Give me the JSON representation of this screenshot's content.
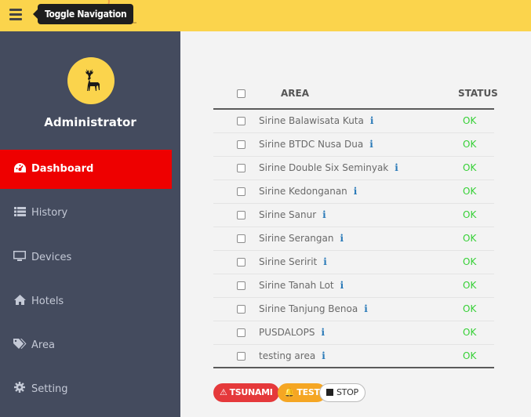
{
  "topbar": {
    "tooltip": "Toggle Navigation"
  },
  "sidebar": {
    "role": "Administrator",
    "items": [
      {
        "label": "Dashboard",
        "icon": "dashboard-icon"
      },
      {
        "label": "History",
        "icon": "list-icon"
      },
      {
        "label": "Devices",
        "icon": "monitor-icon"
      },
      {
        "label": "Hotels",
        "icon": "home-icon"
      },
      {
        "label": "Area",
        "icon": "tag-icon"
      },
      {
        "label": "Setting",
        "icon": "gear-icon"
      }
    ]
  },
  "table": {
    "headers": {
      "area": "AREA",
      "status": "STATUS"
    },
    "info_glyph": "i",
    "rows": [
      {
        "area": "Sirine Balawisata Kuta",
        "status": "OK"
      },
      {
        "area": "Sirine BTDC Nusa Dua",
        "status": "OK"
      },
      {
        "area": "Sirine Double Six Seminyak",
        "status": "OK"
      },
      {
        "area": "Sirine Kedonganan",
        "status": "OK"
      },
      {
        "area": "Sirine Sanur",
        "status": "OK"
      },
      {
        "area": "Sirine Serangan",
        "status": "OK"
      },
      {
        "area": "Sirine Seririt",
        "status": "OK"
      },
      {
        "area": "Sirine Tanah Lot",
        "status": "OK"
      },
      {
        "area": "Sirine Tanjung Benoa",
        "status": "OK"
      },
      {
        "area": "PUSDALOPS",
        "status": "OK"
      },
      {
        "area": "testing area",
        "status": "OK"
      }
    ]
  },
  "actions": {
    "tsunami": "TSUNAMI",
    "test": "TEST",
    "stop": "STOP"
  },
  "colors": {
    "topbar": "#fbd44c",
    "sidebar": "#444b5e",
    "active": "#ee0000",
    "ok": "#35d035",
    "tsunami": "#e5393b",
    "test": "#f5a623"
  }
}
